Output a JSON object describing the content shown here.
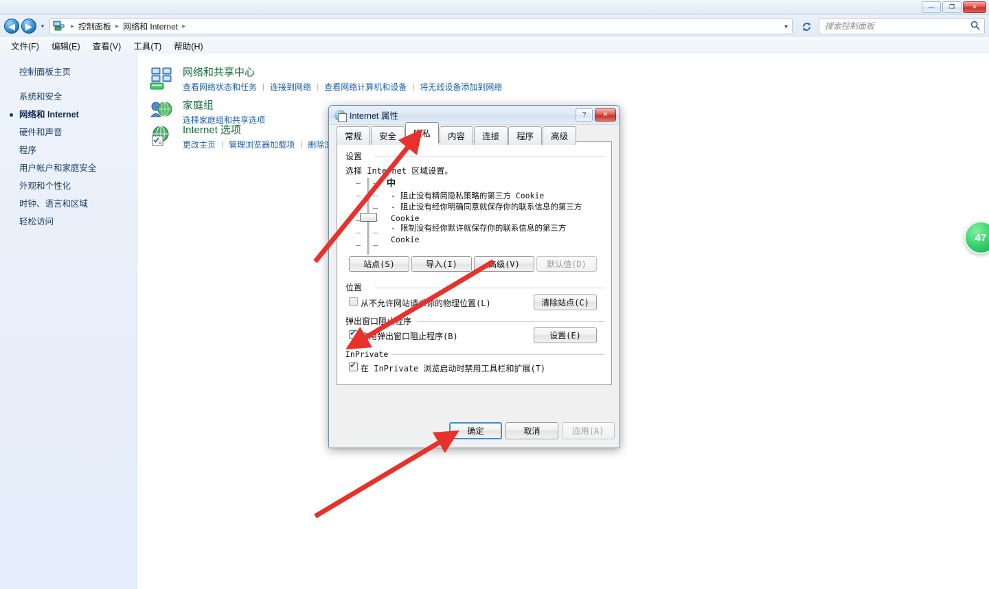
{
  "window": {
    "buttons": {
      "minimize": "—",
      "maximize": "❐",
      "close": "✕"
    }
  },
  "address_bar": {
    "back_icon": "◀",
    "forward_icon": "▶",
    "dropdown_icon": "▾",
    "breadcrumb": [
      "控制面板",
      "网络和 Internet"
    ],
    "separator": "▸",
    "refresh_icon": "↻",
    "search_placeholder": "搜索控制面板",
    "search_value": "",
    "search_icon": "🔍"
  },
  "menubar": {
    "items": [
      "文件(F)",
      "编辑(E)",
      "查看(V)",
      "工具(T)",
      "帮助(H)"
    ]
  },
  "sidebar": {
    "home": "控制面板主页",
    "items": [
      {
        "label": "系统和安全",
        "active": false
      },
      {
        "label": "网络和 Internet",
        "active": true
      },
      {
        "label": "硬件和声音",
        "active": false
      },
      {
        "label": "程序",
        "active": false
      },
      {
        "label": "用户帐户和家庭安全",
        "active": false
      },
      {
        "label": "外观和个性化",
        "active": false
      },
      {
        "label": "时钟、语言和区域",
        "active": false
      },
      {
        "label": "轻松访问",
        "active": false
      }
    ]
  },
  "content": {
    "categories": [
      {
        "title": "网络和共享中心",
        "icon": "network-icon",
        "links": [
          "查看网络状态和任务",
          "连接到网络",
          "查看网络计算机和设备",
          "将无线设备添加到网络"
        ]
      },
      {
        "title": "家庭组",
        "icon": "homegroup-icon",
        "links": [
          "选择家庭组和共享选项"
        ]
      },
      {
        "title": "Internet 选项",
        "icon": "internet-options-icon",
        "links": [
          "更改主页",
          "管理浏览器加载项",
          "删除浏览历史记录和 Cookie"
        ]
      }
    ]
  },
  "dialog": {
    "title": "Internet 属性",
    "help_button": "?",
    "close_button": "✕",
    "tabs": [
      {
        "label": "常规",
        "active": false
      },
      {
        "label": "安全",
        "active": false
      },
      {
        "label": "隐私",
        "active": true
      },
      {
        "label": "内容",
        "active": false
      },
      {
        "label": "连接",
        "active": false
      },
      {
        "label": "程序",
        "active": false
      },
      {
        "label": "高级",
        "active": false
      }
    ],
    "settings_group": {
      "label": "设置",
      "description": "选择 Internet 区域设置。",
      "level_name": "中",
      "level_details": [
        "- 阻止没有精简隐私策略的第三方 Cookie",
        "- 阻止没有经你明确同意就保存你的联系信息的第三方 Cookie",
        "- 限制没有经你默许就保存你的联系信息的第三方 Cookie"
      ],
      "buttons": [
        {
          "label": "站点(S)",
          "disabled": false
        },
        {
          "label": "导入(I)",
          "disabled": false
        },
        {
          "label": "高级(V)",
          "disabled": false
        },
        {
          "label": "默认值(D)",
          "disabled": true
        }
      ]
    },
    "location_group": {
      "label": "位置",
      "checkbox_label": "从不允许网站请求你的物理位置(L)",
      "checkbox_checked": false,
      "button": "清除站点(C)"
    },
    "popup_group": {
      "label": "弹出窗口阻止程序",
      "checkbox_label": "启用弹出窗口阻止程序(B)",
      "checkbox_checked": true,
      "button": "设置(E)"
    },
    "inprivate_group": {
      "label": "InPrivate",
      "checkbox_label": "在 InPrivate 浏览启动时禁用工具栏和扩展(T)",
      "checkbox_checked": true
    },
    "footer_buttons": [
      {
        "label": "确定",
        "default": true,
        "disabled": false
      },
      {
        "label": "取消",
        "default": false,
        "disabled": false
      },
      {
        "label": "应用(A)",
        "default": false,
        "disabled": true
      }
    ]
  },
  "badge": {
    "value": "47"
  },
  "colors": {
    "accent_link": "#1d5fa6",
    "category_title": "#176b3a",
    "sidebar_text": "#1b3d63",
    "annotation_arrow": "#e8312a",
    "badge_green": "#34cf6a"
  }
}
